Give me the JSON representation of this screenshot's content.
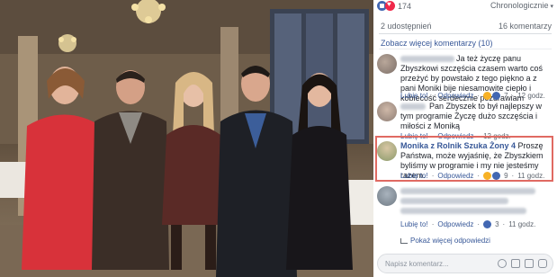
{
  "post": {
    "reaction_count": "174",
    "sort_label": "Chronologicznie",
    "shares": "2 udostępnień",
    "comments_total": "16 komentarzy",
    "more_comments": "Zobacz więcej komentarzy (10)"
  },
  "comments": [
    {
      "text": "Ja też życzę panu Zbyszkowi szczęścia czasem warto coś przeżyć by powstało z tego piękno a z pani Moniki bije niesamowite ciepło i kobiecość serdecznie pozdrawiam",
      "like": "Lubię to!",
      "reply": "Odpowiedz",
      "reactions": "7",
      "time": "12 godz."
    },
    {
      "text": "Pan Zbyszek to był najlepszy w tym programie Życzę dużo szczęścia i miłości z Moniką",
      "like": "Lubię to!",
      "reply": "Odpowiedz",
      "time": "12 godz."
    },
    {
      "author": "Monika z Rolnik Szuka Żony 4",
      "text": "Proszę Państwa, może wyjaśnię, że Zbyszkiem byliśmy w programie i my nie jesteśmy razem.",
      "like": "Lubię to!",
      "reply": "Odpowiedz",
      "reactions": "9",
      "time": "11 godz."
    },
    {
      "like": "Lubię to!",
      "reply": "Odpowiedz",
      "reactions": "3",
      "time": "11 godz."
    }
  ],
  "replies_link": "Pokaż więcej odpowiedzi",
  "composer": {
    "placeholder": "Napisz komentarz..."
  },
  "colors": {
    "link": "#385898",
    "highlight": "#e06a62",
    "like": "#4267b2",
    "love": "#f0284a"
  }
}
